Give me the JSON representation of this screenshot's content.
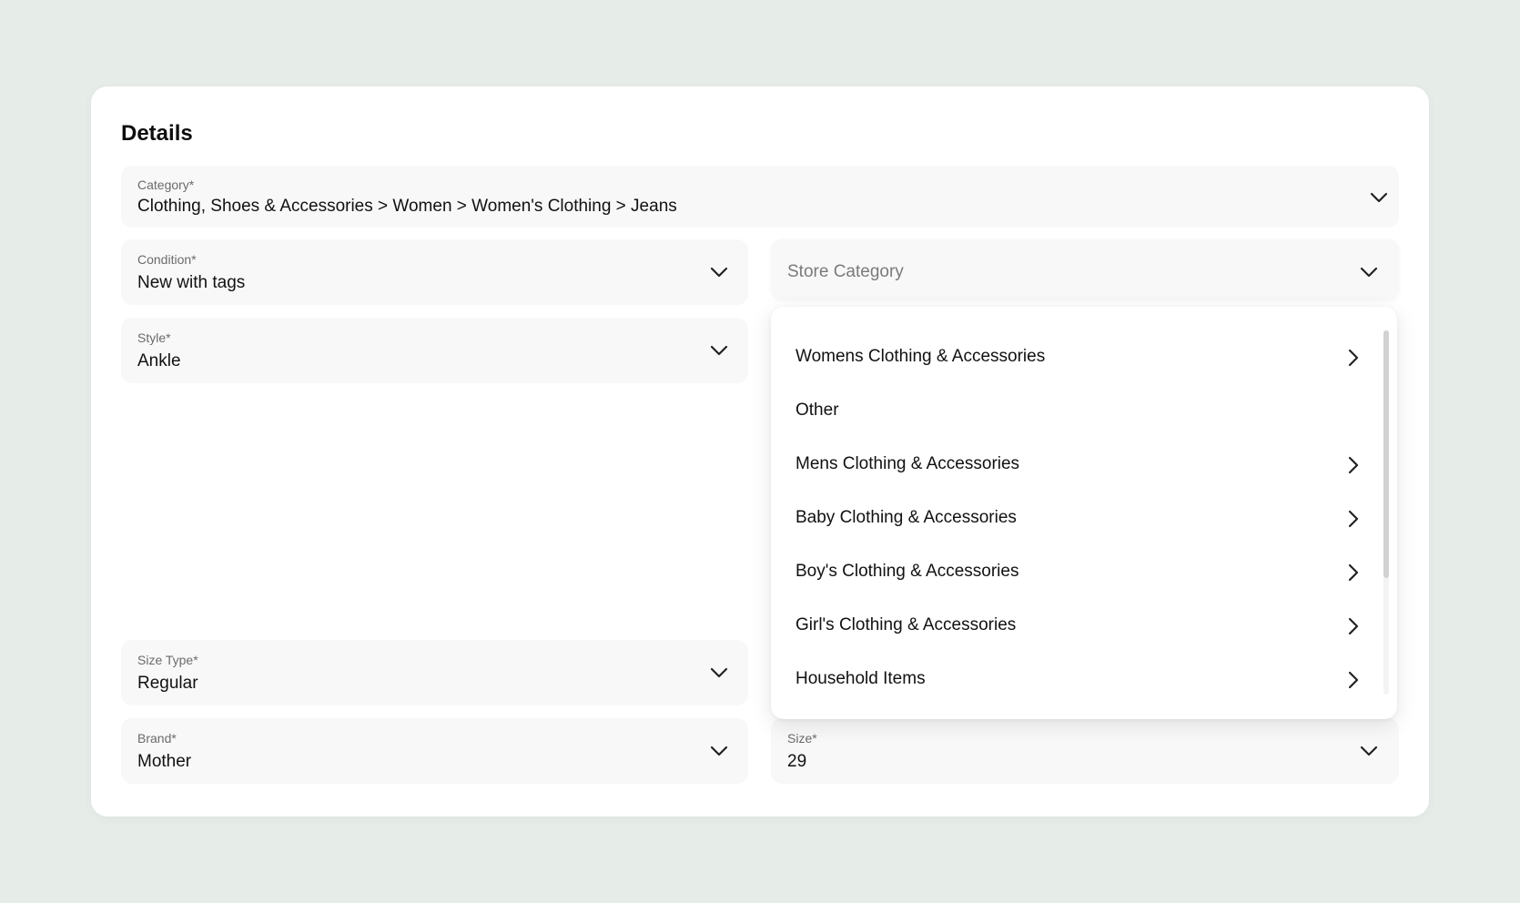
{
  "details": {
    "title": "Details",
    "category": {
      "label": "Category*",
      "value": "Clothing, Shoes & Accessories > Women > Women's Clothing > Jeans"
    },
    "condition": {
      "label": "Condition*",
      "value": "New with tags"
    },
    "store_category": {
      "placeholder": "Store Category"
    },
    "style": {
      "label": "Style*",
      "value": "Ankle"
    },
    "size_type": {
      "label": "Size Type*",
      "value": "Regular"
    },
    "brand": {
      "label": "Brand*",
      "value": "Mother"
    },
    "size": {
      "label": "Size*",
      "value": "29"
    }
  },
  "store_menu": {
    "items": [
      {
        "label": "Womens Clothing & Accessories",
        "has_submenu": true
      },
      {
        "label": "Other",
        "has_submenu": false
      },
      {
        "label": "Mens Clothing & Accessories",
        "has_submenu": true
      },
      {
        "label": "Baby Clothing & Accessories",
        "has_submenu": true
      },
      {
        "label": "Boy's Clothing & Accessories",
        "has_submenu": true
      },
      {
        "label": "Girl's Clothing & Accessories",
        "has_submenu": true
      },
      {
        "label": "Household Items",
        "has_submenu": true
      }
    ]
  },
  "icons": {
    "dropdown": "chevron-down-icon",
    "submenu": "chevron-right-icon"
  },
  "colors": {
    "background": "#e6ece8",
    "card": "#ffffff",
    "field": "#f8f8f8",
    "label": "#6b6b6b"
  }
}
